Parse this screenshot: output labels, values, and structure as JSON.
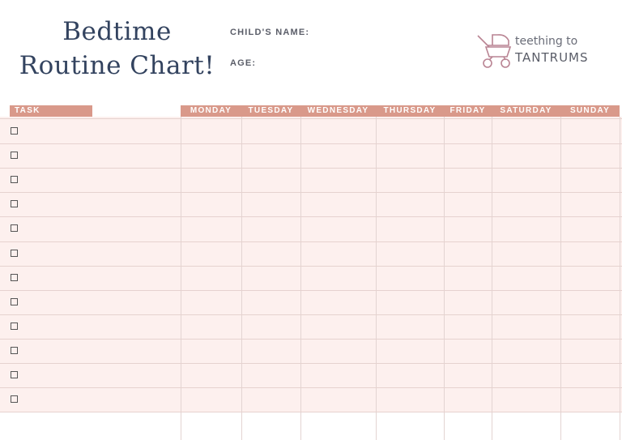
{
  "title": {
    "line1": "Bedtime",
    "line2": "Routine Chart!"
  },
  "fields": {
    "child_name_label": "CHILD'S NAME:",
    "age_label": "AGE:"
  },
  "logo": {
    "icon": "stroller-icon",
    "line1": "teething to",
    "line2": "TANTRUMS"
  },
  "table": {
    "task_header": "TASK",
    "days": [
      "MONDAY",
      "TUESDAY",
      "WEDNESDAY",
      "THURSDAY",
      "FRIDAY",
      "SATURDAY",
      "SUNDAY"
    ],
    "row_count": 12,
    "checked": [
      false,
      false,
      false,
      false,
      false,
      false,
      false,
      false,
      false,
      false,
      false,
      false
    ]
  },
  "colors": {
    "accent": "#d9998a",
    "row_bg": "#fdf0ee",
    "title": "#33435f"
  }
}
